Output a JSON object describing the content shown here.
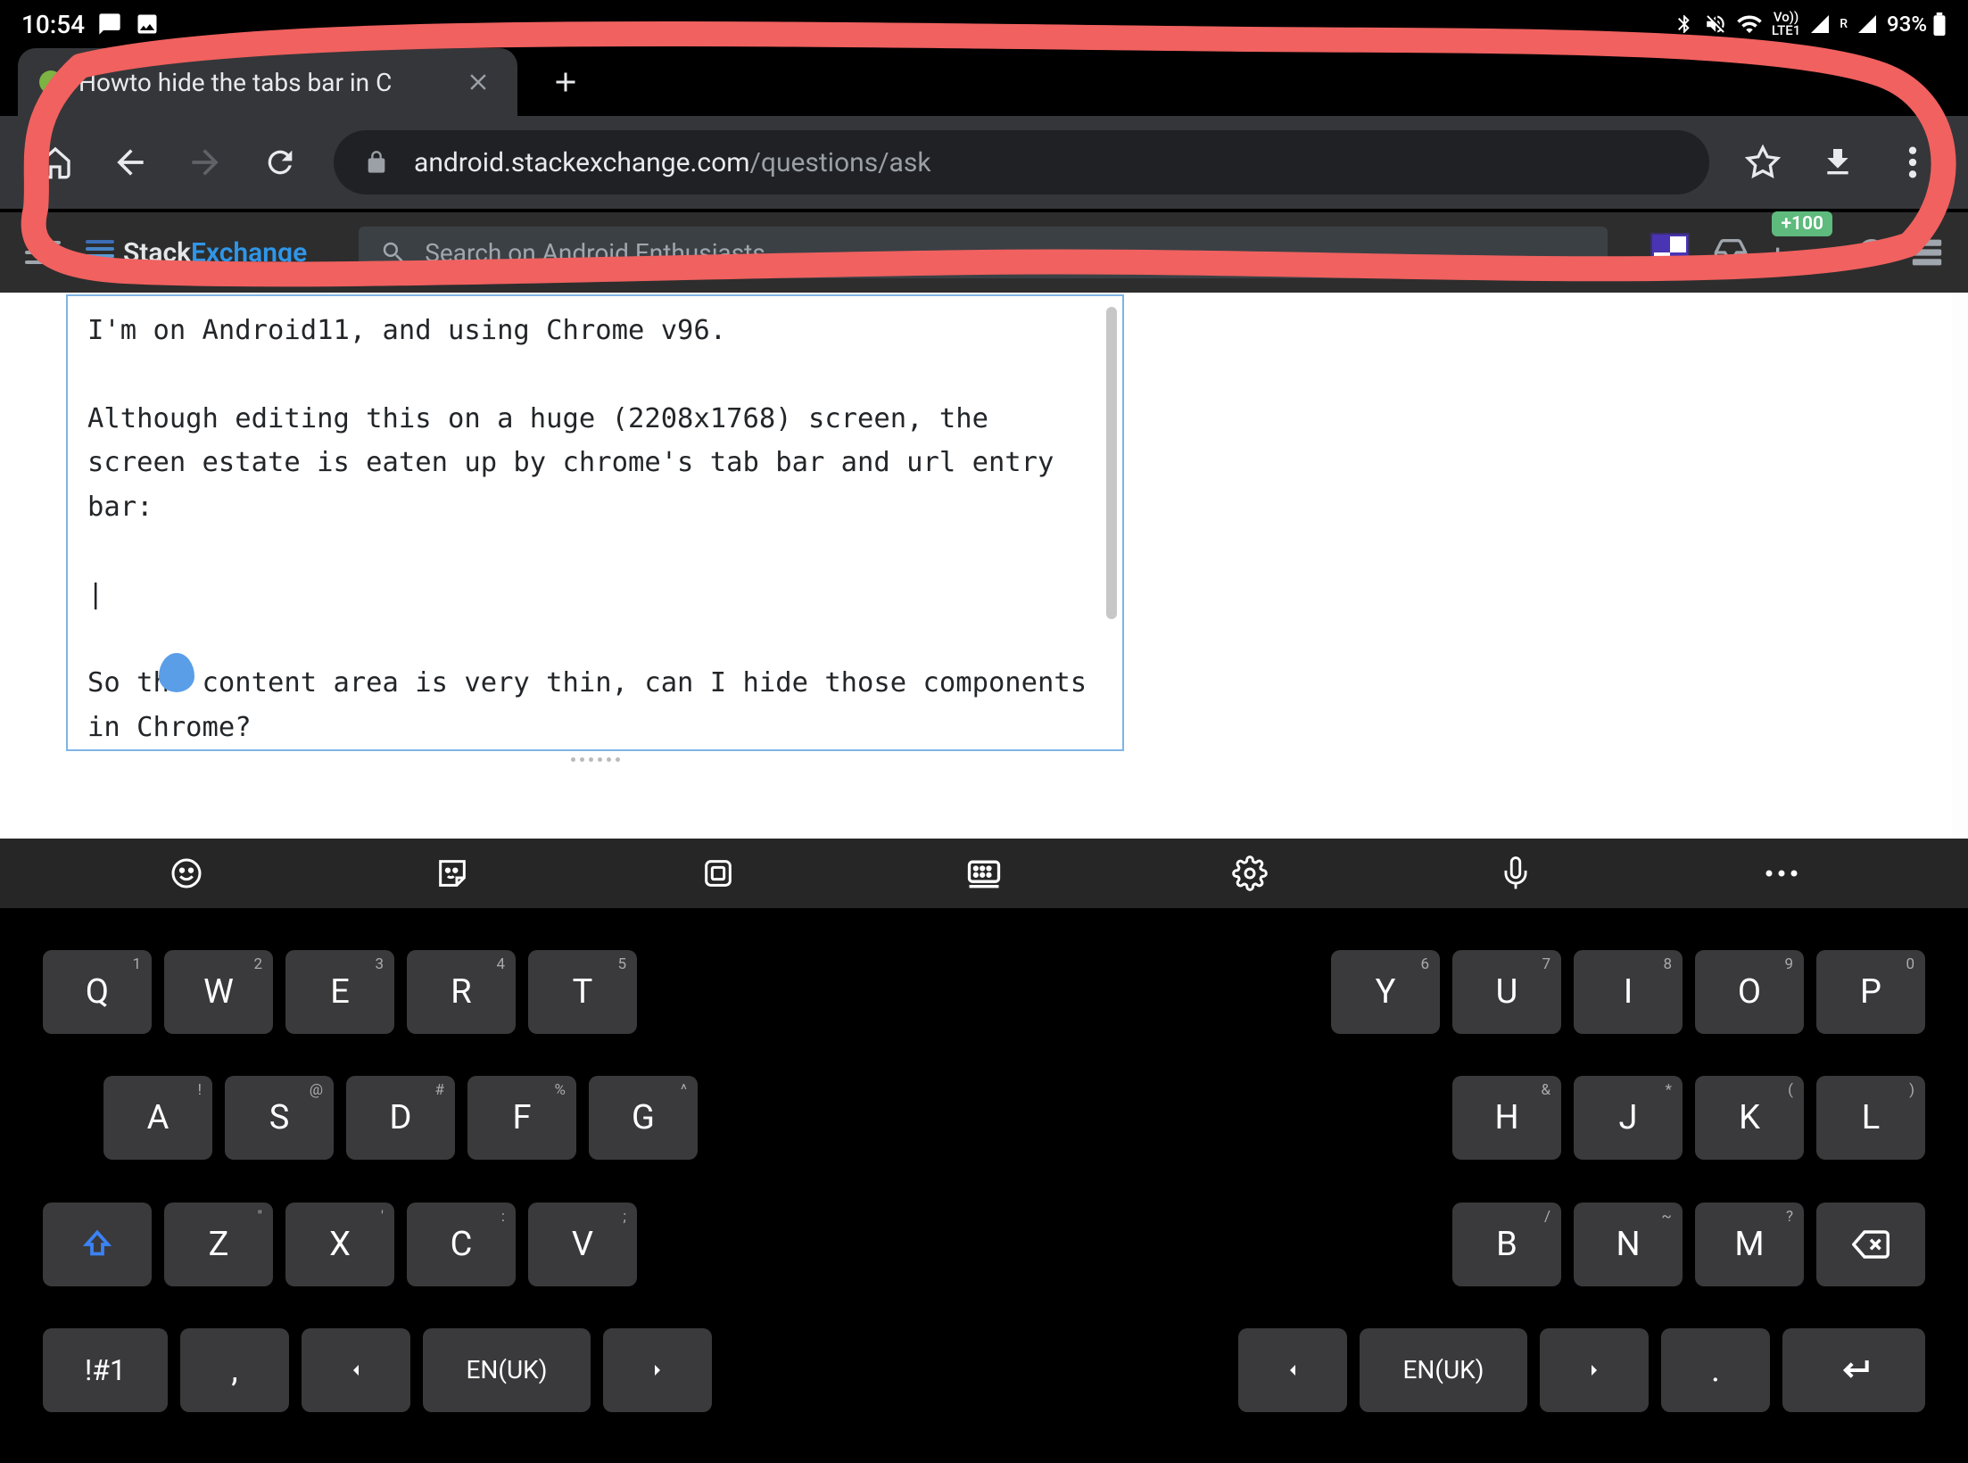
{
  "status": {
    "time": "10:54",
    "battery": "93%",
    "lte": "LTE1",
    "vo": "Vo))",
    "r": "R"
  },
  "browser": {
    "tab_title": "Howto hide the tabs bar in C",
    "url_host": "android.stackexchange.com",
    "url_path": "/questions/ask"
  },
  "se": {
    "logo_stack": "Stack",
    "logo_exchange": "Exchange",
    "search_placeholder": "Search on Android Enthusiasts…",
    "rep_badge": "+100"
  },
  "editor": {
    "text": "I'm on Android11, and using Chrome v96.\n\nAlthough editing this on a huge (2208x1768) screen, the screen estate is eaten up by chrome's tab bar and url entry bar:\n\n|\n\nSo the content area is very thin, can I hide those components in Chrome?"
  },
  "keyboard": {
    "row1_left": [
      {
        "k": "Q",
        "h": "1"
      },
      {
        "k": "W",
        "h": "2"
      },
      {
        "k": "E",
        "h": "3"
      },
      {
        "k": "R",
        "h": "4"
      },
      {
        "k": "T",
        "h": "5"
      }
    ],
    "row1_right": [
      {
        "k": "Y",
        "h": "6"
      },
      {
        "k": "U",
        "h": "7"
      },
      {
        "k": "I",
        "h": "8"
      },
      {
        "k": "O",
        "h": "9"
      },
      {
        "k": "P",
        "h": "0"
      }
    ],
    "row2_left": [
      {
        "k": "A",
        "h": "!"
      },
      {
        "k": "S",
        "h": "@"
      },
      {
        "k": "D",
        "h": "#"
      },
      {
        "k": "F",
        "h": "%"
      },
      {
        "k": "G",
        "h": "^"
      }
    ],
    "row2_right": [
      {
        "k": "H",
        "h": "&"
      },
      {
        "k": "J",
        "h": "*"
      },
      {
        "k": "K",
        "h": "("
      },
      {
        "k": "L",
        "h": ")"
      }
    ],
    "row3_left": [
      {
        "k": "Z",
        "h": "\""
      },
      {
        "k": "X",
        "h": "'"
      },
      {
        "k": "C",
        "h": ":"
      },
      {
        "k": "V",
        "h": ";"
      }
    ],
    "row3_right": [
      {
        "k": "B",
        "h": "/"
      },
      {
        "k": "N",
        "h": "~"
      },
      {
        "k": "M",
        "h": "?"
      }
    ],
    "sym": "!#1",
    "comma": ",",
    "lang": "EN(UK)",
    "lang2": "EN(UK)",
    "period": "."
  }
}
